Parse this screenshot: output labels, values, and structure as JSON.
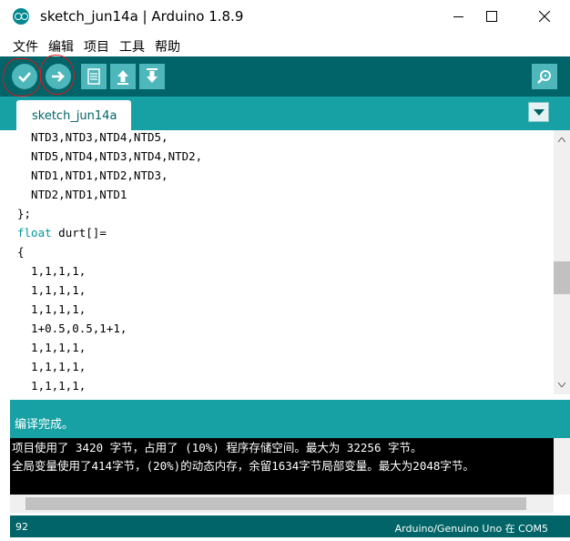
{
  "window": {
    "title": "sketch_jun14a | Arduino 1.8.9"
  },
  "menu": [
    "文件",
    "编辑",
    "项目",
    "工具",
    "帮助"
  ],
  "toolbar": {
    "buttons": [
      "verify",
      "upload",
      "new",
      "open",
      "save"
    ],
    "monitor": "serial-monitor"
  },
  "tabs": [
    {
      "label": "sketch_jun14a",
      "active": true
    }
  ],
  "code": {
    "lines": [
      "  NTD3,NTD3,NTD4,NTD5,",
      "  NTD5,NTD4,NTD3,NTD4,NTD2,",
      "  NTD1,NTD1,NTD2,NTD3,",
      "  NTD2,NTD1,NTD1",
      "};",
      " durt[]=",
      "{",
      "  1,1,1,1,",
      "  1,1,1,1,",
      "  1,1,1,1,",
      "  1+0.5,0.5,1+1,",
      "  1,1,1,1,",
      "  1,1,1,1,",
      "  1,1,1,1,"
    ],
    "keyword": "float"
  },
  "status": {
    "message": "编译完成。"
  },
  "console": {
    "lines": [
      "项目使用了 3420 字节，占用了 (10%) 程序存储空间。最大为 32256 字节。",
      "全局变量使用了414字节，(20%)的动态内存，余留1634字节局部变量。最大为2048字节。"
    ]
  },
  "footer": {
    "line": "92",
    "board": "Arduino/Genuino Uno 在 COM5"
  },
  "colors": {
    "toolbar": "#006468",
    "tabbar": "#17a1a5",
    "button": "#4db7bb",
    "keyword": "#00979d"
  }
}
